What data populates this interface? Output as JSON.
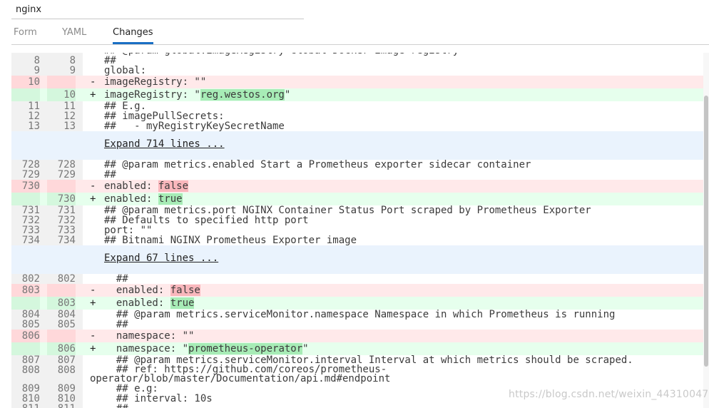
{
  "release_name": "nginx",
  "tabs": [
    {
      "label": "Form",
      "active": false
    },
    {
      "label": "YAML",
      "active": false
    },
    {
      "label": "Changes",
      "active": true
    }
  ],
  "diff_lines": [
    {
      "type": "ctx",
      "old": "",
      "new": "",
      "text": "  ## @param global.imageRegistry Global Docker image registry"
    },
    {
      "type": "ctx",
      "old": "8",
      "new": "8",
      "text": "##"
    },
    {
      "type": "ctx",
      "old": "9",
      "new": "9",
      "text": "global:"
    },
    {
      "type": "del",
      "old": "10",
      "new": "",
      "prefix": "  imageRegistry: \"",
      "hl": "",
      "suffix": "\""
    },
    {
      "type": "add",
      "old": "",
      "new": "10",
      "prefix": "  imageRegistry: \"",
      "hl": "reg.westos.org",
      "suffix": "\""
    },
    {
      "type": "ctx",
      "old": "11",
      "new": "11",
      "text": "  ## E.g."
    },
    {
      "type": "ctx",
      "old": "12",
      "new": "12",
      "text": "  ## imagePullSecrets:"
    },
    {
      "type": "ctx",
      "old": "13",
      "new": "13",
      "text": "  ##   - myRegistryKeySecretName"
    },
    {
      "type": "expand",
      "text": "Expand 714 lines ..."
    },
    {
      "type": "ctx",
      "old": "728",
      "new": "728",
      "text": "  ## @param metrics.enabled Start a Prometheus exporter sidecar container"
    },
    {
      "type": "ctx",
      "old": "729",
      "new": "729",
      "text": "  ##"
    },
    {
      "type": "del",
      "old": "730",
      "new": "",
      "prefix": "  enabled: ",
      "hl": "false",
      "suffix": ""
    },
    {
      "type": "add",
      "old": "",
      "new": "730",
      "prefix": "  enabled: ",
      "hl": "true",
      "suffix": ""
    },
    {
      "type": "ctx",
      "old": "731",
      "new": "731",
      "text": "  ## @param metrics.port NGINX Container Status Port scraped by Prometheus Exporter"
    },
    {
      "type": "ctx",
      "old": "732",
      "new": "732",
      "text": "  ## Defaults to specified http port"
    },
    {
      "type": "ctx",
      "old": "733",
      "new": "733",
      "text": "  port: \"\""
    },
    {
      "type": "ctx",
      "old": "734",
      "new": "734",
      "text": "  ## Bitnami NGINX Prometheus Exporter image"
    },
    {
      "type": "expand",
      "text": "Expand 67 lines ..."
    },
    {
      "type": "ctx",
      "old": "802",
      "new": "802",
      "text": "    ##"
    },
    {
      "type": "del",
      "old": "803",
      "new": "",
      "prefix": "    enabled: ",
      "hl": "false",
      "suffix": ""
    },
    {
      "type": "add",
      "old": "",
      "new": "803",
      "prefix": "    enabled: ",
      "hl": "true",
      "suffix": ""
    },
    {
      "type": "ctx",
      "old": "804",
      "new": "804",
      "text": "    ## @param metrics.serviceMonitor.namespace Namespace in which Prometheus is running"
    },
    {
      "type": "ctx",
      "old": "805",
      "new": "805",
      "text": "    ##"
    },
    {
      "type": "del",
      "old": "806",
      "new": "",
      "prefix": "    namespace: \"",
      "hl": "",
      "suffix": "\""
    },
    {
      "type": "add",
      "old": "",
      "new": "806",
      "prefix": "    namespace: \"",
      "hl": "prometheus-operator",
      "suffix": "\""
    },
    {
      "type": "ctx",
      "old": "807",
      "new": "807",
      "text": "    ## @param metrics.serviceMonitor.interval Interval at which metrics should be scraped."
    },
    {
      "type": "ctx",
      "old": "808",
      "new": "808",
      "text": "    ## ref: https://github.com/coreos/prometheus-\noperator/blob/master/Documentation/api.md#endpoint"
    },
    {
      "type": "ctx",
      "old": "809",
      "new": "809",
      "text": "    ## e.g:"
    },
    {
      "type": "ctx",
      "old": "810",
      "new": "810",
      "text": "    ## interval: 10s"
    },
    {
      "type": "ctx",
      "old": "811",
      "new": "811",
      "text": "    ##"
    }
  ],
  "watermark": "https://blog.csdn.net/weixin_44310047",
  "colors": {
    "del_bg": "#ffe9ea",
    "add_bg": "#e6ffed",
    "del_highlight": "#f9b7bc",
    "add_highlight": "#a7ecb6",
    "expand_bg": "#eaf3fd",
    "active_tab_underline": "#1a6fc4"
  }
}
